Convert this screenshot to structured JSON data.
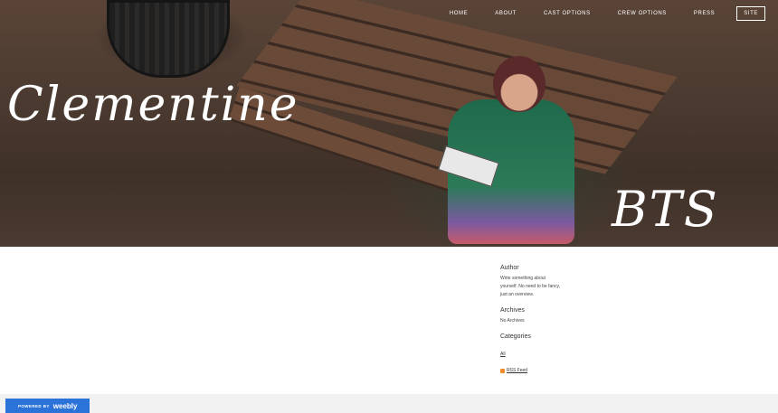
{
  "nav": {
    "items": [
      "HOME",
      "ABOUT",
      "CAST OPTIONS",
      "CREW OPTIONS",
      "PRESS"
    ],
    "button_label": "SITE"
  },
  "hero": {
    "title_left": "Clementine",
    "title_right": "BTS"
  },
  "sidebar": {
    "author": {
      "title": "Author",
      "text": "Write something about yourself. No need to be fancy, just an overview."
    },
    "archives": {
      "title": "Archives",
      "text": "No Archives"
    },
    "categories": {
      "title": "Categories",
      "link": "All"
    },
    "rss": {
      "label": "RSS Feed",
      "icon": "rss-icon"
    }
  },
  "footer": {
    "powered_by": "POWERED BY",
    "brand": "weebly"
  },
  "colors": {
    "badge": "#2b72d9",
    "rss": "#f28c2c"
  }
}
